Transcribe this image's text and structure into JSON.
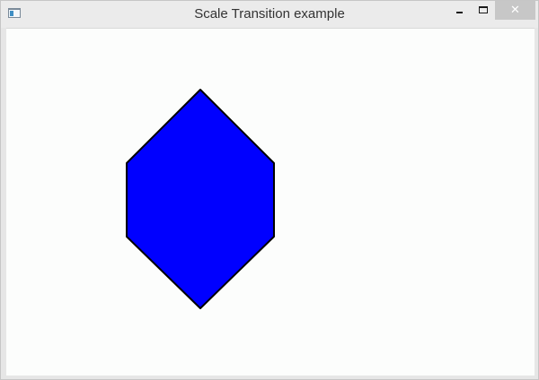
{
  "window": {
    "title": "Scale Transition example",
    "controls": {
      "minimize_icon": "minimize-icon",
      "maximize_icon": "maximize-icon",
      "close_icon": "close-icon",
      "close_glyph": "✕"
    }
  },
  "canvas": {
    "background": "#fcfdfc",
    "shape": {
      "kind": "hexagon",
      "fill": "#0000ff",
      "stroke": "#000000"
    }
  }
}
